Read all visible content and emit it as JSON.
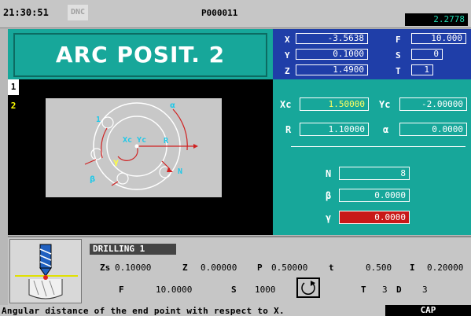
{
  "header": {
    "time": "21:30:51",
    "mode": "DNC",
    "program": "P000011",
    "value": "2.2778"
  },
  "cycle": {
    "title": "ARC POSIT. 2",
    "tabs": [
      "1",
      "2"
    ]
  },
  "diagram": {
    "labels": {
      "alpha": "α",
      "center": "Xc Yc",
      "radius": "R",
      "n": "N",
      "beta": "β",
      "gamma": "γ",
      "one": "1"
    }
  },
  "axes": {
    "x": {
      "label": "X",
      "value": "-3.5638"
    },
    "y": {
      "label": "Y",
      "value": "0.1000"
    },
    "z": {
      "label": "Z",
      "value": "1.4900"
    },
    "f": {
      "label": "F",
      "value": "10.000"
    },
    "s": {
      "label": "S",
      "value": "0"
    },
    "t": {
      "label": "T",
      "value": "1"
    }
  },
  "params": {
    "xc": {
      "label": "Xc",
      "value": "1.50000"
    },
    "yc": {
      "label": "Yc",
      "value": "-2.00000"
    },
    "r": {
      "label": "R",
      "value": "1.10000"
    },
    "alpha": {
      "label": "α",
      "value": "0.0000"
    },
    "n": {
      "label": "N",
      "value": "8"
    },
    "beta": {
      "label": "β",
      "value": "0.0000"
    },
    "gamma": {
      "label": "γ",
      "value": "0.0000"
    }
  },
  "drilling": {
    "name": "DRILLING 1",
    "row1": [
      {
        "label": "Zs",
        "value": "0.10000"
      },
      {
        "label": "Z",
        "value": "0.00000"
      },
      {
        "label": "P",
        "value": "0.50000"
      },
      {
        "label": "t",
        "value": "0.500"
      },
      {
        "label": "I",
        "value": "0.20000"
      }
    ],
    "row2": [
      {
        "label": "F",
        "value": "10.0000"
      },
      {
        "label": "S",
        "value": "1000"
      },
      {
        "label": "T",
        "value": "3"
      },
      {
        "label": "D",
        "value": "3"
      }
    ]
  },
  "status": {
    "message": "Angular distance of the end point with respect to X.",
    "caps": "CAP"
  },
  "colors": {
    "teal": "#17a79a",
    "blue": "#1f3ea8",
    "red": "#c81818",
    "yellow": "#ffff00",
    "cyan": "#20d8b0"
  }
}
